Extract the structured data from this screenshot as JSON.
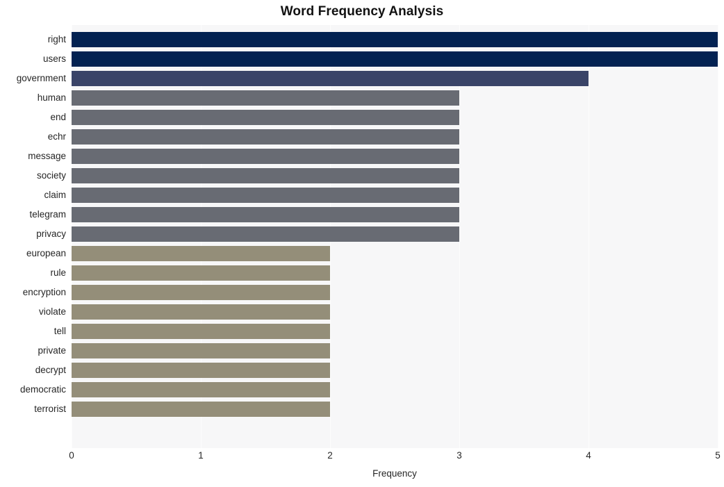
{
  "chart_data": {
    "type": "bar",
    "orientation": "horizontal",
    "title": "Word Frequency Analysis",
    "xlabel": "Frequency",
    "ylabel": "",
    "categories": [
      "right",
      "users",
      "government",
      "human",
      "end",
      "echr",
      "message",
      "society",
      "claim",
      "telegram",
      "privacy",
      "european",
      "rule",
      "encryption",
      "violate",
      "tell",
      "private",
      "decrypt",
      "democratic",
      "terrorist"
    ],
    "values": [
      5,
      5,
      4,
      3,
      3,
      3,
      3,
      3,
      3,
      3,
      3,
      2,
      2,
      2,
      2,
      2,
      2,
      2,
      2,
      2
    ],
    "bar_colors": [
      "#032252",
      "#032252",
      "#3a4468",
      "#686b73",
      "#686b73",
      "#686b73",
      "#686b73",
      "#686b73",
      "#686b73",
      "#686b73",
      "#686b73",
      "#948e79",
      "#948e79",
      "#948e79",
      "#948e79",
      "#948e79",
      "#948e79",
      "#948e79",
      "#948e79",
      "#948e79"
    ],
    "xlim": [
      0,
      5
    ],
    "x_ticks": [
      0,
      1,
      2,
      3,
      4,
      5
    ],
    "x_tick_labels": [
      "0",
      "1",
      "2",
      "3",
      "4",
      "5"
    ],
    "grid": true,
    "grid_axis": "x",
    "legend": false,
    "plot_background": "#f7f7f8",
    "figure_background": "#ffffff",
    "gridline_color": "#fdfdfd",
    "title_color": "#121212",
    "tick_label_color": "#262626"
  }
}
